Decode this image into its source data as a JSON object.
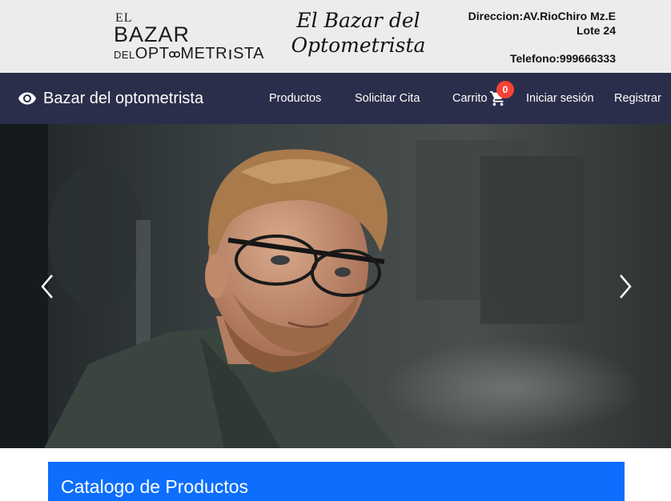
{
  "header": {
    "logo": {
      "line1": "EL",
      "line2": "BAZAR",
      "line3_prefix": "DEL",
      "line3_a": "OPT",
      "line3_b": "METR",
      "line3_c": "STA"
    },
    "script_title_line1": "El Bazar del",
    "script_title_line2": "Optometrista",
    "address_line1": "Direccion:AV.RioChiro Mz.E",
    "address_line2": "Lote 24",
    "phone": "Telefono:999666333"
  },
  "navbar": {
    "brand": "Bazar del optometrista",
    "links": {
      "productos": "Productos",
      "cita": "Solicitar Cita",
      "carrito": "Carrito",
      "login": "Iniciar sesión",
      "registrar": "Registrar"
    },
    "cart_count": "0"
  },
  "hero": {
    "icons": {
      "prev": "chevron-left-icon",
      "next": "chevron-right-icon"
    }
  },
  "catalog": {
    "title": "Catalogo de Productos"
  },
  "colors": {
    "navbar_bg": "#2b2e4a",
    "badge": "#f44336",
    "catalog_header": "#0d6efd",
    "topband_bg": "#ececec"
  }
}
